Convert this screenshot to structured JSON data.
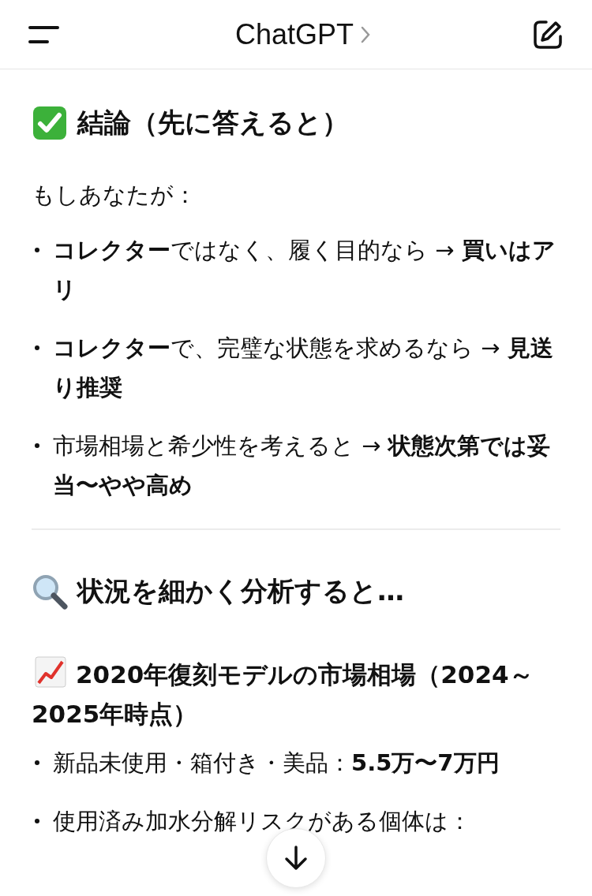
{
  "header": {
    "title": "ChatGPT"
  },
  "sections": [
    {
      "kind": "check",
      "heading": "結論（先に答えると）",
      "intro": "もしあなたが：",
      "bullets": [
        "**コレクター**ではなく、履く目的なら → **買いはアリ**",
        "**コレクター**で、完璧な状態を求めるなら → **見送り推奨**",
        "市場相場と希少性を考えると → **状態次第では妥当〜やや高め**"
      ]
    },
    {
      "kind": "search",
      "heading": "状況を細かく分析すると…",
      "subsections": [
        {
          "kind": "chart",
          "heading": "2020年復刻モデルの市場相場（2024～2025年時点）",
          "bullets": [
            "新品未使用・箱付き・美品：**5.5万〜7万円**",
            "使用済み加水分解リスクがある個体は："
          ]
        }
      ]
    }
  ]
}
